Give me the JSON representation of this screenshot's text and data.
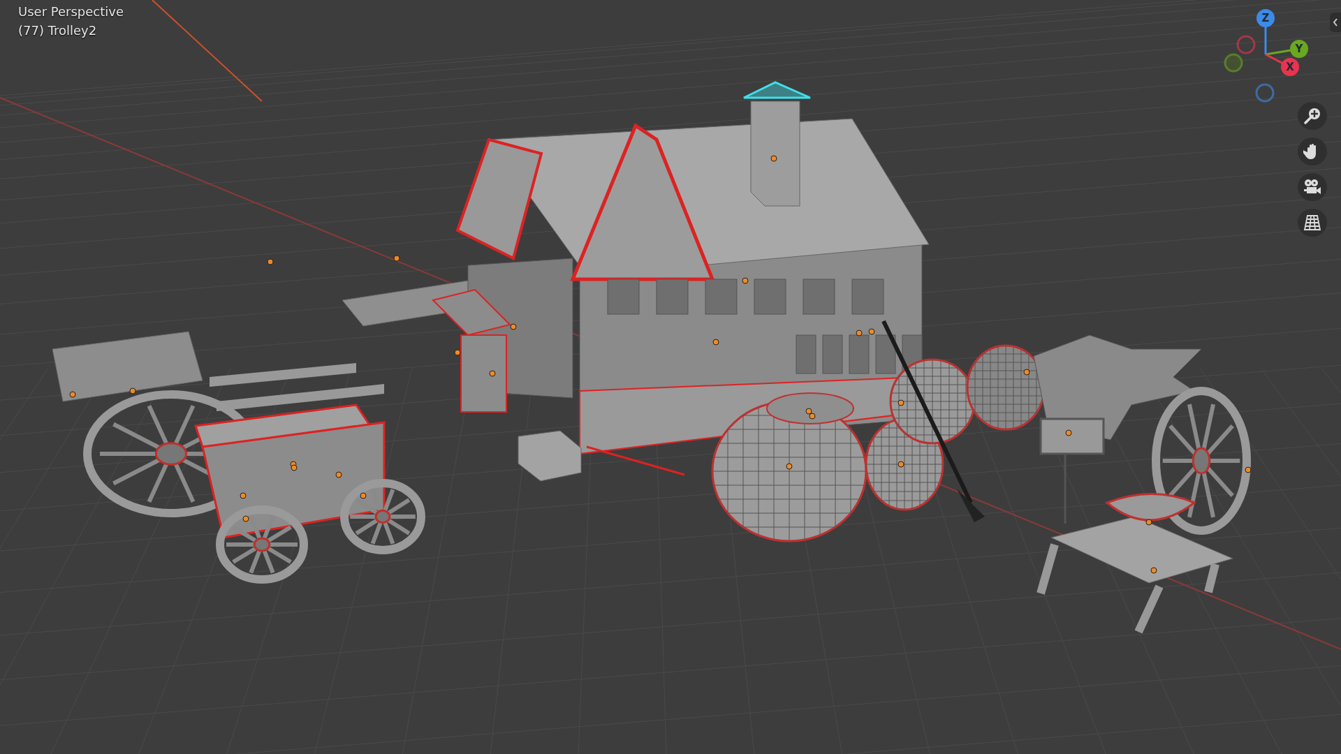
{
  "viewport": {
    "mode": "User Perspective",
    "object": "(77) Trolley2"
  },
  "gizmo": {
    "axes": [
      {
        "label": "Z",
        "color": "#3d8be8"
      },
      {
        "label": "Y",
        "color": "#6aa820"
      },
      {
        "label": "X",
        "color": "#e8344f"
      }
    ]
  },
  "nav_buttons": [
    {
      "kind": "zoom"
    },
    {
      "kind": "pan"
    },
    {
      "kind": "camera"
    },
    {
      "kind": "ortho"
    }
  ]
}
